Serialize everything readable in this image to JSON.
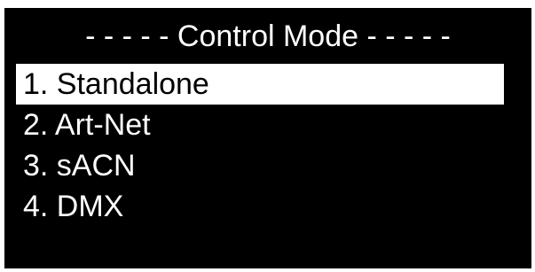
{
  "title": "- - - - - Control Mode - - - - -",
  "menu": {
    "items": [
      {
        "label": "1. Standalone",
        "selected": true
      },
      {
        "label": "2. Art-Net",
        "selected": false
      },
      {
        "label": "3. sACN",
        "selected": false
      },
      {
        "label": "4. DMX",
        "selected": false
      }
    ]
  },
  "colors": {
    "background": "#000000",
    "text": "#ffffff",
    "highlight": "#ffffff",
    "highlight_text": "#000000"
  }
}
